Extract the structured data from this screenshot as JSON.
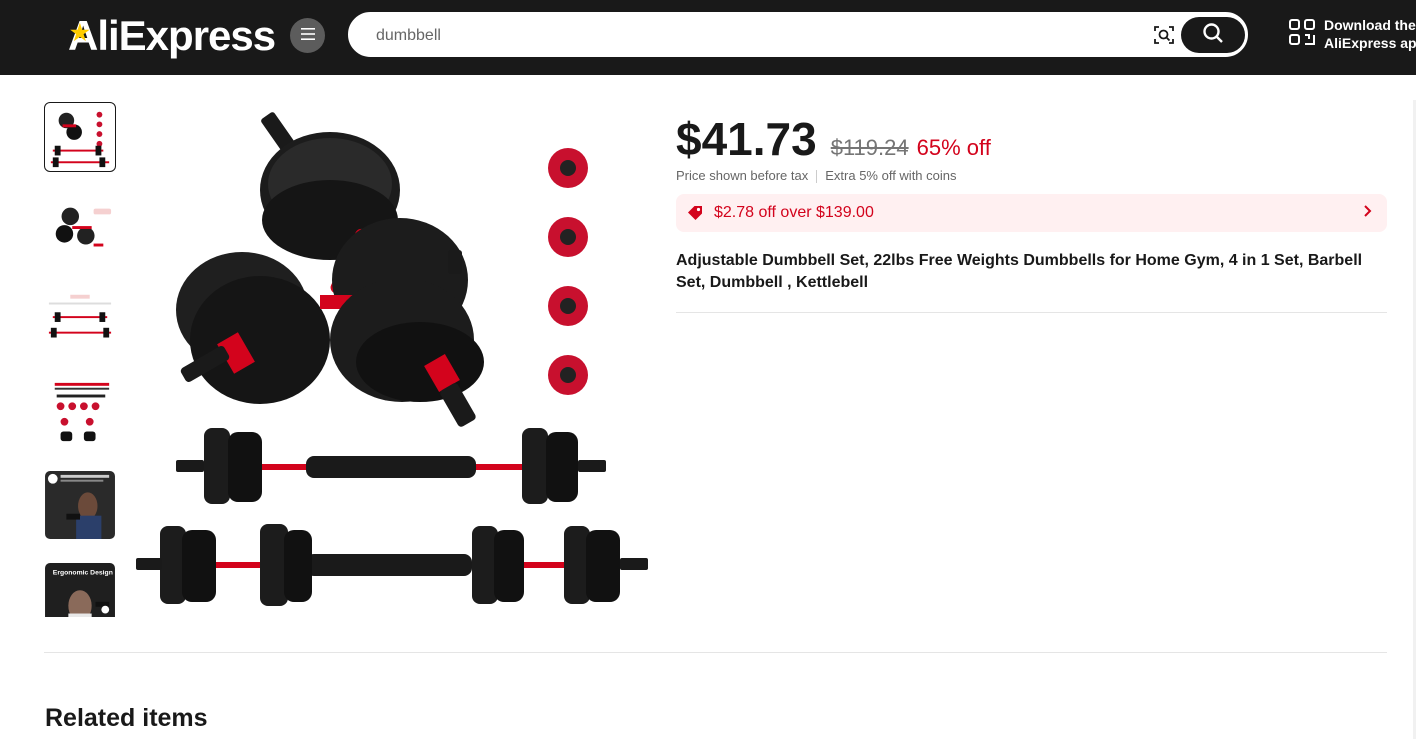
{
  "header": {
    "logo_text": "AliExpress",
    "search_value": "dumbbell",
    "app_download_line1": "Download the",
    "app_download_line2": "AliExpress app"
  },
  "icons": {
    "menu": "menu-icon",
    "image_search": "camera-search-icon",
    "search": "search-icon",
    "qr": "qr-code-icon",
    "coupon": "coupon-tag-icon",
    "chevron": "chevron-right-icon"
  },
  "product": {
    "price": "$41.73",
    "original_price": "$119.24",
    "discount": "65% off",
    "tax_note": "Price shown before tax",
    "coins_note": "Extra 5% off with coins",
    "coupon_text": "$2.78 off over $139.00",
    "title": "Adjustable Dumbbell Set, 22lbs Free Weights Dumbbells for Home Gym, 4 in 1 Set, Barbell Set, Dumbbell , Kettlebell"
  },
  "thumbnails": {
    "thumb5_caption": "",
    "thumb6_caption": "Ergonomic Design"
  },
  "sections": {
    "related_title": "Related items"
  },
  "colors": {
    "header_bg": "#191919",
    "accent_red": "#d3031c",
    "coupon_bg": "#fff0f1",
    "logo_star": "#ffcc00"
  }
}
